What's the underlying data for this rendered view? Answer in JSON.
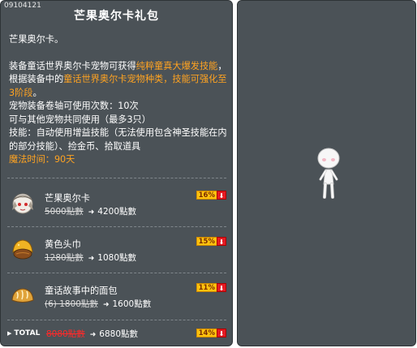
{
  "item_id": "09104121",
  "title": "芒果奥尔卡礼包",
  "description": {
    "intro": "芒果奥尔卡。",
    "para_prefix": "装备童话世界奥尔卡宠物可获得",
    "para_highlight1": "纯粹童真大爆发技能",
    "para_mid": "，根据装备中的",
    "para_highlight2": "童话世界奥尔卡宠物种类，技能可强化至3阶段",
    "para_suffix": "。",
    "scroll_line": "宠物装备卷轴可使用次数：10次",
    "share_line": "可与其他宠物共同使用（最多3只）",
    "skills_line": "技能：自动使用增益技能（无法使用包含神圣技能在内的部分技能）、捡金币、拾取道具",
    "magic_time": "魔法时间：90天"
  },
  "items": [
    {
      "name": "芒果奥尔卡",
      "original_price": "5000點數",
      "sale_price": "4200點數",
      "discount": "16%",
      "icon": "orca-pet-icon"
    },
    {
      "name": "黄色头巾",
      "original_price": "1280點數",
      "sale_price": "1080點數",
      "discount": "15%",
      "icon": "yellow-bandana-icon"
    },
    {
      "name": "童话故事中的面包",
      "original_price": "(6) 1800點數",
      "sale_price": "1600點數",
      "discount": "11%",
      "icon": "bread-icon"
    }
  ],
  "total": {
    "label": "TOTAL",
    "original_price": "8080點數",
    "sale_price": "6880點數",
    "discount": "14%"
  },
  "colors": {
    "panel_bg": "#4b5257",
    "highlight": "#ffa321",
    "badge": "#ffc20e",
    "badge_arrow": "#e51b24"
  }
}
